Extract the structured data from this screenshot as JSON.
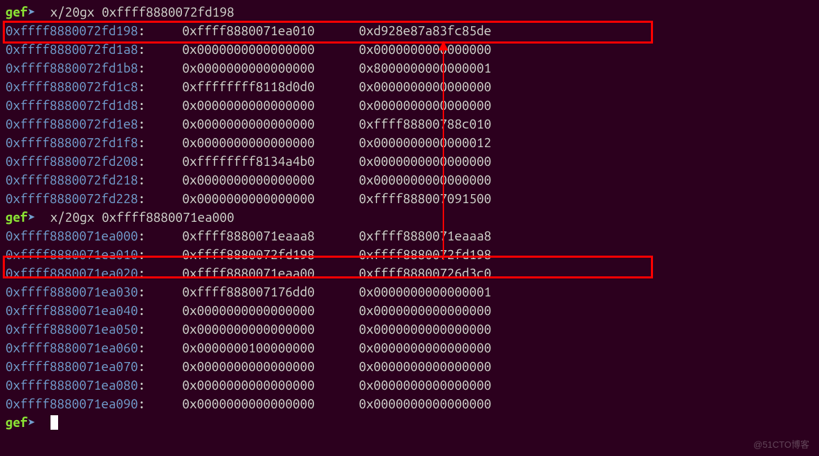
{
  "prompt_label": "gef",
  "prompt_arrow": "➤",
  "commands": [
    "x/20gx 0xffff8880072fd198",
    "x/20gx 0xffff8880071ea000",
    ""
  ],
  "dump1": [
    {
      "addr": "0xffff8880072fd198",
      "v1": "0xffff8880071ea010",
      "v2": "0xd928e87a83fc85de"
    },
    {
      "addr": "0xffff8880072fd1a8",
      "v1": "0x0000000000000000",
      "v2": "0x0000000000000000"
    },
    {
      "addr": "0xffff8880072fd1b8",
      "v1": "0x0000000000000000",
      "v2": "0x8000000000000001"
    },
    {
      "addr": "0xffff8880072fd1c8",
      "v1": "0xffffffff8118d0d0",
      "v2": "0x0000000000000000"
    },
    {
      "addr": "0xffff8880072fd1d8",
      "v1": "0x0000000000000000",
      "v2": "0x0000000000000000"
    },
    {
      "addr": "0xffff8880072fd1e8",
      "v1": "0x0000000000000000",
      "v2": "0xffff88800788c010"
    },
    {
      "addr": "0xffff8880072fd1f8",
      "v1": "0x0000000000000000",
      "v2": "0x0000000000000012"
    },
    {
      "addr": "0xffff8880072fd208",
      "v1": "0xffffffff8134a4b0",
      "v2": "0x0000000000000000"
    },
    {
      "addr": "0xffff8880072fd218",
      "v1": "0x0000000000000000",
      "v2": "0x0000000000000000"
    },
    {
      "addr": "0xffff8880072fd228",
      "v1": "0x0000000000000000",
      "v2": "0xffff888007091500"
    }
  ],
  "dump2": [
    {
      "addr": "0xffff8880071ea000",
      "v1": "0xffff8880071eaaa8",
      "v2": "0xffff8880071eaaa8"
    },
    {
      "addr": "0xffff8880071ea010",
      "v1": "0xffff8880072fd198",
      "v2": "0xffff8880072fd198"
    },
    {
      "addr": "0xffff8880071ea020",
      "v1": "0xffff8880071eaa00",
      "v2": "0xffff88800726d3c0"
    },
    {
      "addr": "0xffff8880071ea030",
      "v1": "0xffff888007176dd0",
      "v2": "0x0000000000000001"
    },
    {
      "addr": "0xffff8880071ea040",
      "v1": "0x0000000000000000",
      "v2": "0x0000000000000000"
    },
    {
      "addr": "0xffff8880071ea050",
      "v1": "0x0000000000000000",
      "v2": "0x0000000000000000"
    },
    {
      "addr": "0xffff8880071ea060",
      "v1": "0x0000000100000000",
      "v2": "0x0000000000000000"
    },
    {
      "addr": "0xffff8880071ea070",
      "v1": "0x0000000000000000",
      "v2": "0x0000000000000000"
    },
    {
      "addr": "0xffff8880071ea080",
      "v1": "0x0000000000000000",
      "v2": "0x0000000000000000"
    },
    {
      "addr": "0xffff8880071ea090",
      "v1": "0x0000000000000000",
      "v2": "0x0000000000000000"
    }
  ],
  "watermark": "@51CTO博客"
}
